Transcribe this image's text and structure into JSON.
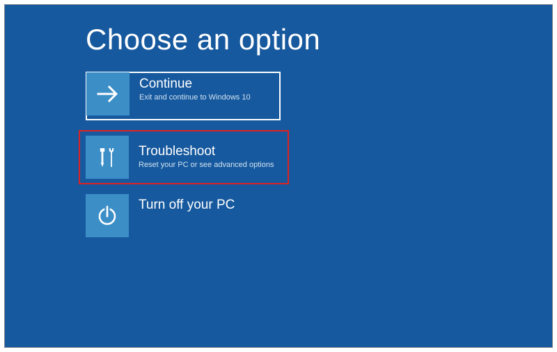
{
  "title": "Choose an option",
  "options": [
    {
      "key": "continue",
      "icon": "arrow-right-icon",
      "title": "Continue",
      "subtitle": "Exit and continue to Windows 10",
      "selected": true,
      "highlighted": false
    },
    {
      "key": "troubleshoot",
      "icon": "tools-icon",
      "title": "Troubleshoot",
      "subtitle": "Reset your PC or see advanced options",
      "selected": false,
      "highlighted": true
    },
    {
      "key": "turnoff",
      "icon": "power-icon",
      "title": "Turn off your PC",
      "subtitle": "",
      "selected": false,
      "highlighted": false
    }
  ]
}
